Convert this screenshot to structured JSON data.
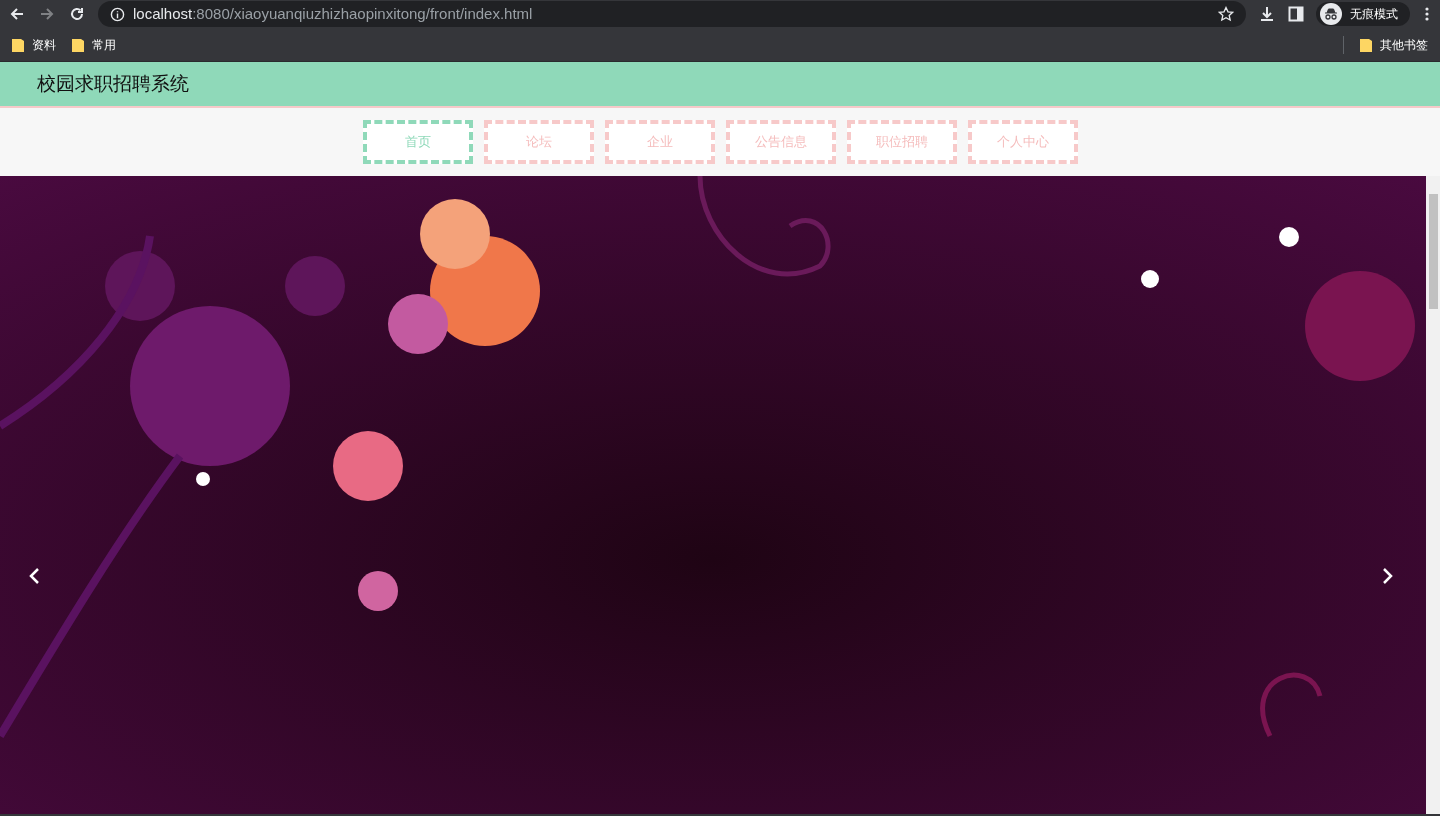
{
  "browser": {
    "url_host": "localhost",
    "url_path": ":8080/xiaoyuanqiuzhizhaopinxitong/front/index.html",
    "profile_label": "无痕模式"
  },
  "bookmarks": [
    {
      "label": "资料"
    },
    {
      "label": "常用"
    }
  ],
  "other_bookmarks": "其他书签",
  "site_title": "校园求职招聘系统",
  "nav": [
    {
      "label": "首页",
      "selected": true
    },
    {
      "label": "论坛",
      "selected": false
    },
    {
      "label": "企业",
      "selected": false
    },
    {
      "label": "公告信息",
      "selected": false
    },
    {
      "label": "职位招聘",
      "selected": false
    },
    {
      "label": "个人中心",
      "selected": false
    }
  ]
}
